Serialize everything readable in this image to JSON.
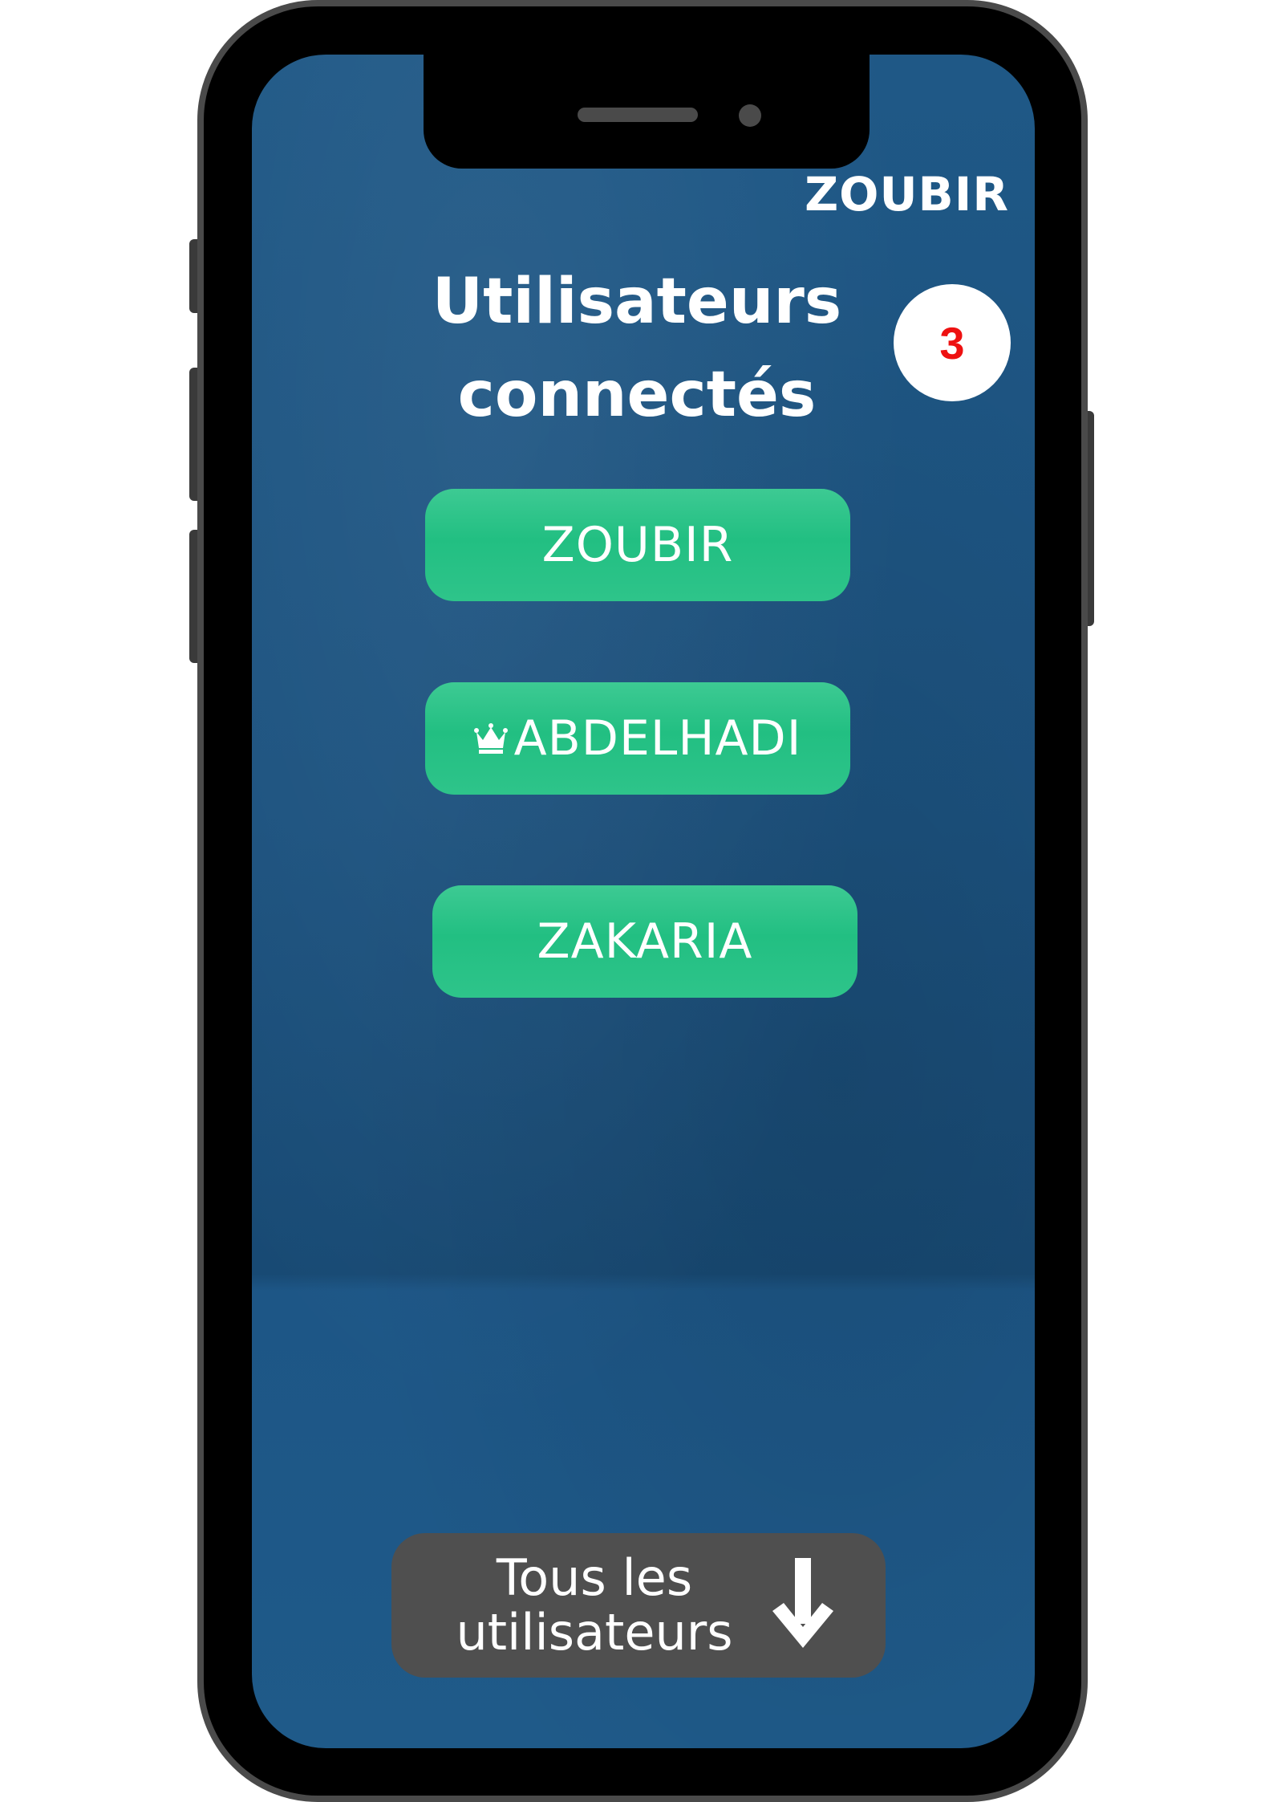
{
  "header": {
    "current_user": "ZOUBIR"
  },
  "title": {
    "line1": "Utilisateurs",
    "line2": "connectés"
  },
  "connected_count": "3",
  "users": [
    {
      "name": "ZOUBIR",
      "is_admin": false
    },
    {
      "name": "ABDELHADI",
      "is_admin": true,
      "icon": "crown-icon"
    },
    {
      "name": "ZAKARIA",
      "is_admin": false
    }
  ],
  "all_users_button": {
    "line1": "Tous les",
    "line2": "utilisateurs",
    "icon": "arrow-down-icon"
  },
  "colors": {
    "background": "#1c527f",
    "button_green": "#2ec48a",
    "badge_text": "#ee1111",
    "bottom_button": "#4f4f4f"
  }
}
